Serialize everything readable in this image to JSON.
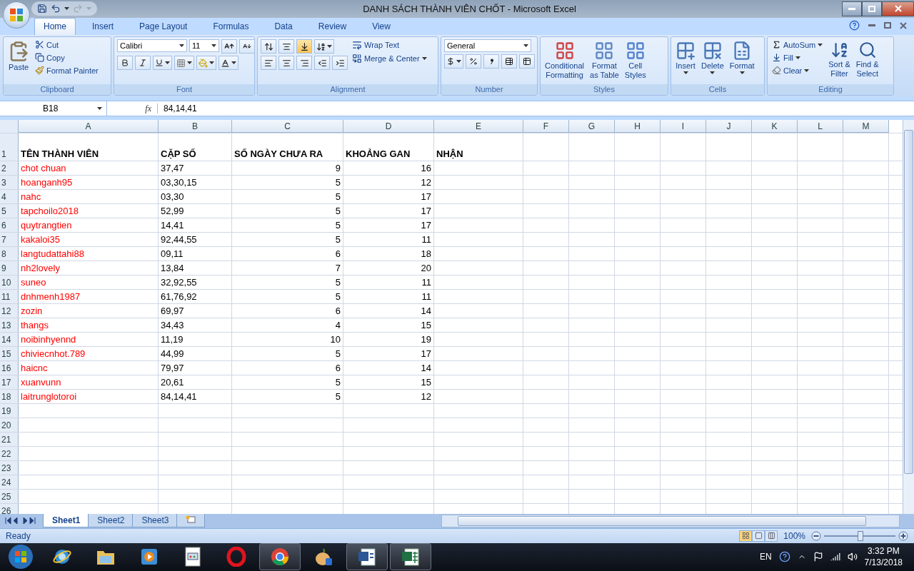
{
  "window": {
    "title": "DANH SÁCH THÀNH VIÊN CHỐT - Microsoft Excel"
  },
  "ribbon": {
    "tabs": [
      {
        "label": "Home",
        "selected": true
      },
      {
        "label": "Insert",
        "selected": false
      },
      {
        "label": "Page Layout",
        "selected": false
      },
      {
        "label": "Formulas",
        "selected": false
      },
      {
        "label": "Data",
        "selected": false
      },
      {
        "label": "Review",
        "selected": false
      },
      {
        "label": "View",
        "selected": false
      }
    ],
    "clipboard": {
      "label": "Clipboard",
      "paste": "Paste",
      "cut": "Cut",
      "copy": "Copy",
      "format_painter": "Format Painter"
    },
    "font": {
      "label": "Font",
      "font_name": "Calibri",
      "font_size": "11"
    },
    "alignment": {
      "label": "Alignment",
      "wrap_text": "Wrap Text",
      "merge_center": "Merge & Center",
      "vertical": [
        {
          "kind": "top",
          "selected": false
        },
        {
          "kind": "middle",
          "selected": false
        },
        {
          "kind": "bottom",
          "selected": true
        }
      ]
    },
    "number": {
      "label": "Number",
      "format": "General"
    },
    "styles": {
      "label": "Styles",
      "buttons": [
        [
          "Conditional",
          "Formatting"
        ],
        [
          "Format",
          "as Table"
        ],
        [
          "Cell",
          "Styles"
        ]
      ]
    },
    "cells": {
      "label": "Cells",
      "buttons": [
        "Insert",
        "Delete",
        "Format"
      ]
    },
    "editing": {
      "label": "Editing",
      "autosum": "AutoSum",
      "fill": "Fill",
      "clear": "Clear",
      "buttons": [
        [
          "Sort &",
          "Filter"
        ],
        [
          "Find &",
          "Select"
        ]
      ]
    }
  },
  "formula_bar": {
    "name_box": "B18",
    "function_label": "fx",
    "value": "84,14,41"
  },
  "sheet": {
    "columns": [
      "A",
      "B",
      "C",
      "D",
      "E",
      "F",
      "G",
      "H",
      "I",
      "J",
      "K",
      "L",
      "M"
    ],
    "rows": [
      {
        "number": "1",
        "kind": "header",
        "cells": [
          "TÊN THÀNH VIÊN",
          "CẶP SỐ",
          "SỐ NGÀY CHƯA RA",
          "KHOẢNG GAN",
          "NHẬN"
        ]
      },
      {
        "number": "2",
        "kind": "data",
        "cells": [
          "chot chuan",
          "37,47",
          "9",
          "16"
        ]
      },
      {
        "number": "3",
        "kind": "data",
        "cells": [
          "hoanganh95",
          "03,30,15",
          "5",
          "12"
        ]
      },
      {
        "number": "4",
        "kind": "data",
        "cells": [
          "nahc",
          "03,30",
          "5",
          "17"
        ]
      },
      {
        "number": "5",
        "kind": "data",
        "cells": [
          "tapchoilo2018",
          "52,99",
          "5",
          "17"
        ]
      },
      {
        "number": "6",
        "kind": "data",
        "cells": [
          "quytrangtien",
          "14,41",
          "5",
          "17"
        ]
      },
      {
        "number": "7",
        "kind": "data",
        "cells": [
          "kakaloi35",
          "92,44,55",
          "5",
          "11"
        ]
      },
      {
        "number": "8",
        "kind": "data",
        "cells": [
          "langtudattahi88",
          "09,11",
          "6",
          "18"
        ]
      },
      {
        "number": "9",
        "kind": "data",
        "cells": [
          "nh2lovely",
          "13,84",
          "7",
          "20"
        ]
      },
      {
        "number": "10",
        "kind": "data",
        "cells": [
          "suneo",
          "32,92,55",
          "5",
          "11"
        ]
      },
      {
        "number": "11",
        "kind": "data",
        "cells": [
          "dnhmenh1987",
          "61,76,92",
          "5",
          "11"
        ]
      },
      {
        "number": "12",
        "kind": "data",
        "cells": [
          "zozin",
          "69,97",
          "6",
          "14"
        ]
      },
      {
        "number": "13",
        "kind": "data",
        "cells": [
          "thangs",
          "34,43",
          "4",
          "15"
        ]
      },
      {
        "number": "14",
        "kind": "data",
        "cells": [
          "noibinhyennd",
          "11,19",
          "10",
          "19"
        ]
      },
      {
        "number": "15",
        "kind": "data",
        "cells": [
          "chiviecnhot.789",
          "44,99",
          "5",
          "17"
        ]
      },
      {
        "number": "16",
        "kind": "data",
        "cells": [
          "haicnc",
          "79,97",
          "6",
          "14"
        ]
      },
      {
        "number": "17",
        "kind": "data",
        "cells": [
          "xuanvunn",
          "20,61",
          "5",
          "15"
        ]
      },
      {
        "number": "18",
        "kind": "data",
        "cells": [
          "laitrunglotoroi",
          "84,14,41",
          "5",
          "12"
        ]
      },
      {
        "number": "19",
        "kind": "data",
        "cells": []
      },
      {
        "number": "20",
        "kind": "data",
        "cells": []
      },
      {
        "number": "21",
        "kind": "data",
        "cells": []
      },
      {
        "number": "22",
        "kind": "data",
        "cells": []
      },
      {
        "number": "23",
        "kind": "data",
        "cells": []
      },
      {
        "number": "24",
        "kind": "data",
        "cells": []
      },
      {
        "number": "25",
        "kind": "data",
        "cells": []
      },
      {
        "number": "26",
        "kind": "data",
        "cells": []
      }
    ]
  },
  "sheet_tabs": [
    {
      "label": "Sheet1",
      "selected": true
    },
    {
      "label": "Sheet2",
      "selected": false
    },
    {
      "label": "Sheet3",
      "selected": false
    }
  ],
  "status_bar": {
    "status": "Ready",
    "views": [
      {
        "kind": "normal",
        "selected": true
      },
      {
        "kind": "layout",
        "selected": false
      },
      {
        "kind": "break",
        "selected": false
      }
    ],
    "zoom": "100%",
    "zoom_level": {
      "level": 0.5
    }
  },
  "taskbar": {
    "apps": [
      {
        "kind": "globe",
        "running": false
      },
      {
        "kind": "folder",
        "running": false
      },
      {
        "kind": "play",
        "running": false
      },
      {
        "kind": "document",
        "running": false
      },
      {
        "kind": "ring",
        "running": false
      },
      {
        "kind": "wheel",
        "running": true
      },
      {
        "kind": "onion",
        "running": false
      },
      {
        "kind": "word",
        "running": true
      },
      {
        "kind": "sheet",
        "running": true
      }
    ],
    "language": "EN",
    "time": "3:32 PM",
    "date": "7/13/2018"
  }
}
